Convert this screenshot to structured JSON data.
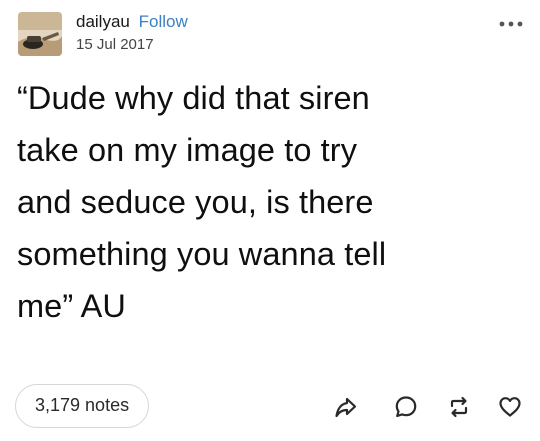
{
  "post": {
    "username": "dailyau",
    "follow_label": "Follow",
    "date": "15 Jul 2017",
    "text": "“Dude why did that siren\ntake on my image to try\nand seduce you, is there\nsomething you wanna tell\nme” AU",
    "notes": "3,179 notes"
  },
  "icons": {
    "more": "more-options-icon",
    "share": "share-icon",
    "reply": "reply-icon",
    "reblog": "reblog-icon",
    "like": "heart-icon"
  },
  "colors": {
    "text": "#111111",
    "follow": "#3b82c4",
    "muted": "#444444",
    "border": "#d6d6d6"
  }
}
